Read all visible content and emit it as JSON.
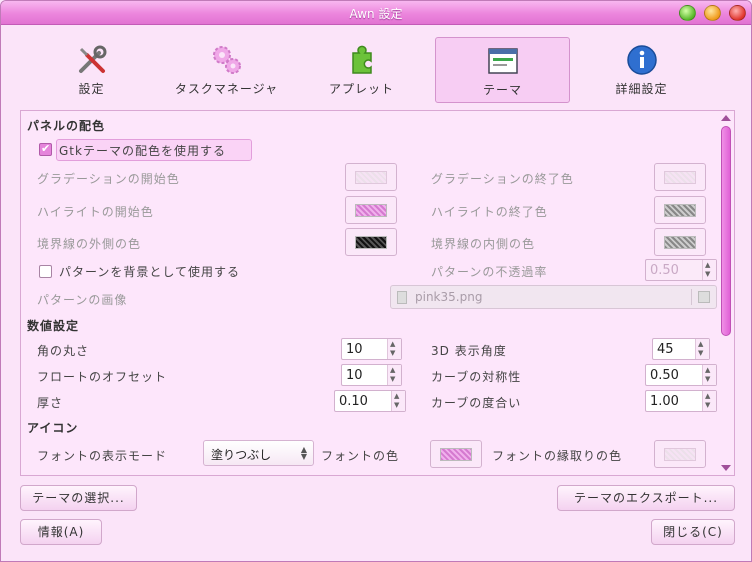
{
  "window": {
    "title": "Awn 設定"
  },
  "tabs": [
    {
      "label": "設定",
      "icon": "tools-icon"
    },
    {
      "label": "タスクマネージャ",
      "icon": "gears-icon"
    },
    {
      "label": "アプレット",
      "icon": "puzzle-icon"
    },
    {
      "label": "テーマ",
      "icon": "theme-window-icon"
    },
    {
      "label": "詳細設定",
      "icon": "info-icon"
    }
  ],
  "panel": {
    "section1": "パネルの配色",
    "use_gtk_colors": "Gtkテーマの配色を使用する",
    "grad_start": "グラデーションの開始色",
    "grad_end": "グラデーションの終了色",
    "highlight_start": "ハイライトの開始色",
    "highlight_end": "ハイライトの終了色",
    "border_outer": "境界線の外側の色",
    "border_inner": "境界線の内側の色",
    "use_pattern": "パターンを背景として使用する",
    "pattern_alpha": "パターンの不透過率",
    "pattern_alpha_value": "0.50",
    "pattern_image": "パターンの画像",
    "pattern_file": "pink35.png",
    "section2": "数値設定",
    "corner_radius": "角の丸さ",
    "corner_radius_value": "10",
    "angle3d": "3D 表示角度",
    "angle3d_value": "45",
    "float_offset": "フロートのオフセット",
    "float_offset_value": "10",
    "curve_symmetry": "カーブの対称性",
    "curve_symmetry_value": "0.50",
    "thickness": "厚さ",
    "thickness_value": "0.10",
    "curve_degree": "カーブの度合い",
    "curve_degree_value": "1.00",
    "section3": "アイコン",
    "font_mode": "フォントの表示モード",
    "font_mode_value": "塗りつぶし",
    "font_color": "フォントの色",
    "font_outline_color": "フォントの縁取りの色"
  },
  "buttons": {
    "select_theme": "テーマの選択...",
    "export_theme": "テーマのエクスポート...",
    "about": "情報(A)",
    "close": "閉じる(C)"
  },
  "colors": {
    "accent": "#e584db",
    "titlebar": "#ec86dd"
  }
}
